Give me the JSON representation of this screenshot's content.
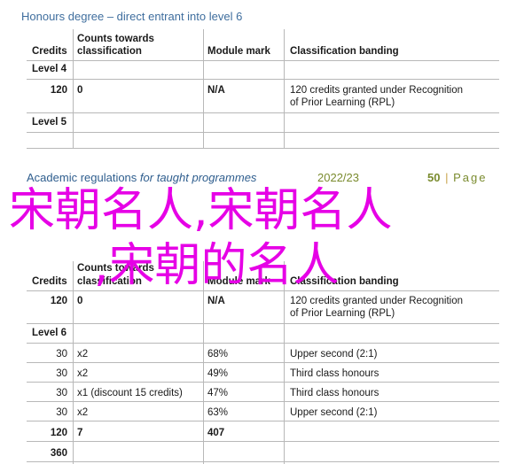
{
  "top_section": {
    "title": "Honours degree – direct entrant into level 6",
    "headers": {
      "credits": "Credits",
      "counts_line1": "Counts towards",
      "counts_line2": "classification",
      "module_mark": "Module mark",
      "classification": "Classification banding"
    },
    "level4": "Level 4",
    "row": {
      "credits": "120",
      "counts": "0",
      "mark": "N/A",
      "banding_line1": "120 credits granted under Recognition",
      "banding_line2": "of Prior Learning (RPL)"
    },
    "level5": "Level 5"
  },
  "footer": {
    "title": "Academic regulations",
    "title_italic": "for taught programmes",
    "year": "2022/23",
    "page_number": "50",
    "page_separator": "|",
    "page_word": "Page"
  },
  "overlay": {
    "line1": "宋朝名人,宋朝名人",
    "line2": ",宋朝的名人"
  },
  "bottom_section": {
    "headers": {
      "credits": "Credits",
      "counts_line1": "Counts towards",
      "counts_line2": "classification",
      "module_mark": "Module mark",
      "classification": "Classification banding"
    },
    "rpl_row": {
      "credits": "120",
      "counts": "0",
      "mark": "N/A",
      "banding_line1": "120 credits granted under Recognition",
      "banding_line2": "of Prior Learning (RPL)"
    },
    "level6": "Level 6",
    "rows": [
      {
        "credits": "30",
        "counts": "x2",
        "mark": "68%",
        "banding": "Upper second (2:1)"
      },
      {
        "credits": "30",
        "counts": "x2",
        "mark": "49%",
        "banding": "Third class honours"
      },
      {
        "credits": "30",
        "counts": "x1 (discount 15 credits)",
        "mark": "47%",
        "banding": "Third class honours"
      },
      {
        "credits": "30",
        "counts": "x2",
        "mark": "63%",
        "banding": "Upper second (2:1)"
      }
    ],
    "total_row": {
      "credits": "120",
      "counts": "7",
      "mark": "407"
    },
    "grand_total": "360"
  }
}
